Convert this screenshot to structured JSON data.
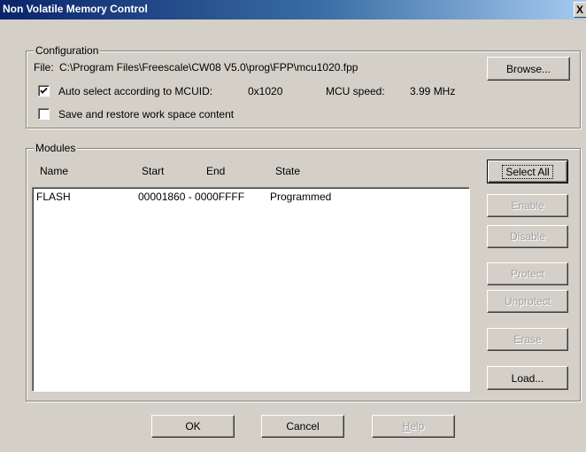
{
  "window": {
    "title": "Non Volatile Memory Control",
    "close_label": "X"
  },
  "configuration": {
    "legend": "Configuration",
    "file_label": "File:",
    "file_path": "C:\\Program Files\\Freescale\\CW08 V5.0\\prog\\FPP\\mcu1020.fpp",
    "browse_label": "Browse...",
    "auto_select": {
      "label": "Auto select according to MCUID:",
      "checked": true,
      "mcuid": "0x1020"
    },
    "mcu_speed_label": "MCU speed:",
    "mcu_speed_value": "3.99 MHz",
    "save_restore": {
      "label": "Save and restore work space content",
      "checked": false
    }
  },
  "modules": {
    "legend": "Modules",
    "columns": [
      "Name",
      "Start",
      "End",
      "State"
    ],
    "rows": [
      {
        "name": "FLASH",
        "range": "00001860 - 0000FFFF",
        "state": "Programmed"
      }
    ],
    "buttons": {
      "select_all": "Select All",
      "enable": "Enable",
      "disable": "Disable",
      "protect": "Protect",
      "unprotect": "Unprotect",
      "erase": "Erase",
      "load": "Load..."
    }
  },
  "footer": {
    "ok": "OK",
    "cancel": "Cancel",
    "help_prefix": "",
    "help_hotkey": "H",
    "help_rest": "elp"
  }
}
